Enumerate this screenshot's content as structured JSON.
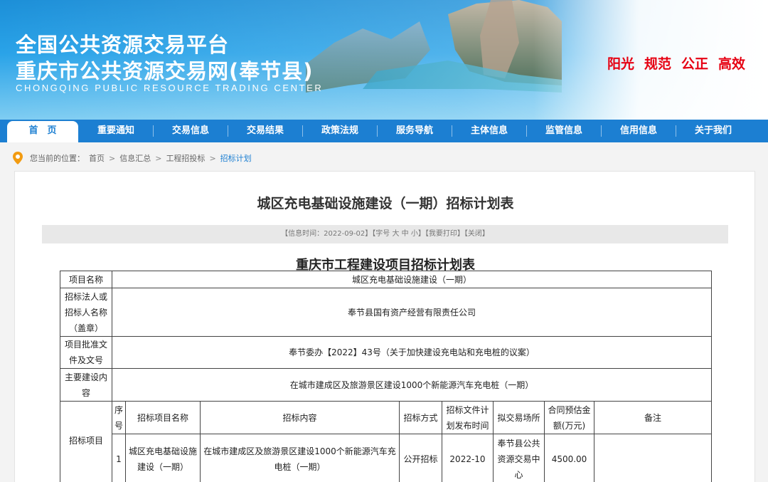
{
  "header": {
    "title_line1": "全国公共资源交易平台",
    "title_line2": "重庆市公共资源交易网(奉节县)",
    "title_en": "CHONGQING PUBLIC RESOURCE TRADING CENTER",
    "slogans": [
      "阳光",
      "规范",
      "公正",
      "高效"
    ]
  },
  "nav": {
    "items": [
      "首　页",
      "重要通知",
      "交易信息",
      "交易结果",
      "政策法规",
      "服务导航",
      "主体信息",
      "监管信息",
      "信用信息",
      "关于我们"
    ]
  },
  "breadcrumb": {
    "prefix": "您当前的位置：",
    "items": [
      "首页",
      "信息汇总",
      "工程招投标",
      "招标计划"
    ],
    "sep": ">"
  },
  "article": {
    "title": "城区充电基础设施建设（一期）招标计划表",
    "infobar": "【信息时间：2022-09-02】【字号 大 中 小】【我要打印】【关闭】",
    "doc_title": "重庆市工程建设项目招标计划表"
  },
  "table": {
    "rows": [
      {
        "label": "项目名称",
        "value": "城区充电基础设施建设（一期）"
      },
      {
        "label": "招标法人或招标人名称（盖章）",
        "value": "奉节县国有资产经营有限责任公司"
      },
      {
        "label": "项目批准文件及文号",
        "value": "奉节委办【2022】43号（关于加快建设充电站和充电桩的议案）"
      },
      {
        "label": "主要建设内容",
        "value": "在城市建成区及旅游景区建设1000个新能源汽车充电桩（一期）"
      }
    ],
    "section_label": "招标项目",
    "headers": [
      "序号",
      "招标项目名称",
      "招标内容",
      "招标方式",
      "招标文件计划发布时间",
      "拟交易场所",
      "合同预估金额(万元)",
      "备注"
    ],
    "items": [
      {
        "no": "1",
        "name": "城区充电基础设施建设（一期）",
        "content": "在城市建成区及旅游景区建设1000个新能源汽车充电桩（一期）",
        "method": "公开招标",
        "time": "2022-10",
        "venue": "奉节县公共资源交易中心",
        "amount": "4500.00",
        "remark": ""
      }
    ]
  }
}
